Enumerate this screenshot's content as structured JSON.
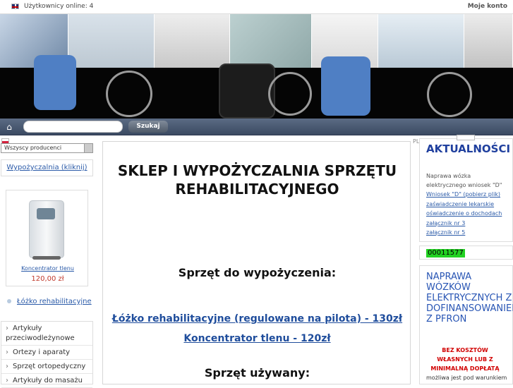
{
  "topbar": {
    "online": "Użytkownicy online: 4",
    "account": "Moje konto"
  },
  "nav": {
    "search_placeholder": "",
    "search_button": "Szukaj"
  },
  "sidebar": {
    "producer_select": "Wszyscy producenci",
    "rental_link": "Wypożyczalnia (kliknij)",
    "product": {
      "name": "Koncentrator tlenu",
      "price": "120,00 zł"
    },
    "bed_link": "Łóżko rehabilitacyjne",
    "categories": [
      "Artykuły przeciwodleżynowe",
      "Ortezy i aparaty",
      "Sprzęt ortopedyczny",
      "Artykuły do masażu"
    ]
  },
  "main": {
    "title": "SKLEP I WYPOŻYCZALNIA SPRZĘTU REHABILITACYJNEGO",
    "rent_heading": "Sprzęt do wypożyczenia:",
    "rent_items": [
      "Łóżko rehabilitacyjne (regulowane na pilota) - 130zł",
      "Koncentrator tlenu - 120zł"
    ],
    "used_heading": "Sprzęt używany:"
  },
  "right": {
    "pl_marker": "PL",
    "news_title": "AKTUALNOŚCI",
    "news_items": [
      "Naprawa wózka elektrycznego wniosek \"D\"",
      "Wniosek \"D\" (pobierz plik)",
      "zaświadczenie lekarskie",
      "oświadczenie o dochodach",
      "załącznik nr 3",
      "załącznik nr 5"
    ],
    "counter": "00011577",
    "ad_title": "NAPRAWA WÓZKÓW ELEKTRYCZNYCH Z DOFINANSOWANIEM Z PFRON",
    "ad_red": "BEZ KOSZTÓW WŁASNYCH LUB Z MINIMALNĄ DOPŁATĄ",
    "ad_bottom": "możliwa jest pod warunkiem"
  },
  "colors": {
    "accent": "#1f4d9c",
    "price": "#c0392b",
    "counter_bg": "#22d122",
    "nav": "#4a5870"
  }
}
